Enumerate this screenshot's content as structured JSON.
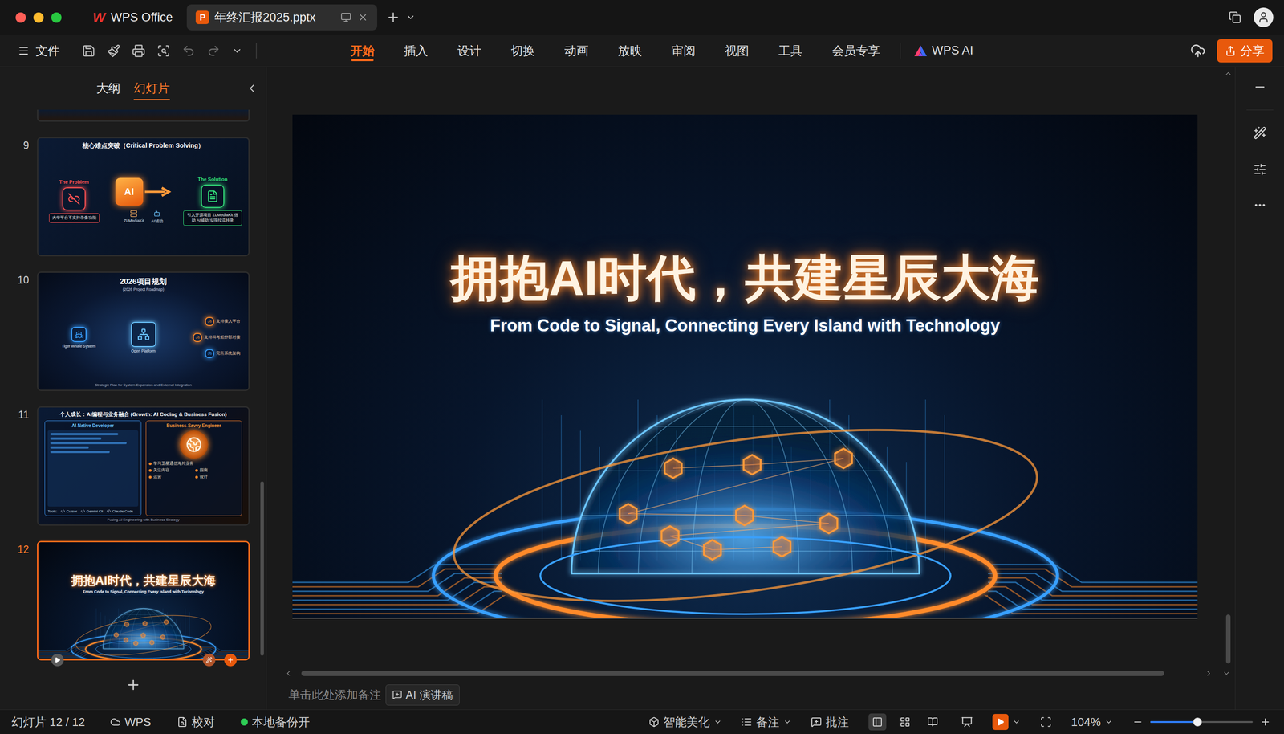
{
  "window": {
    "tabs": [
      {
        "label": "WPS Office",
        "kind": "home",
        "icon": "W",
        "selected": false
      },
      {
        "label": "年终汇报2025.pptx",
        "kind": "doc",
        "icon": "P",
        "selected": true
      }
    ]
  },
  "toolbar": {
    "file": "文件",
    "menus": [
      {
        "label": "开始",
        "selected": true
      },
      {
        "label": "插入",
        "selected": false
      },
      {
        "label": "设计",
        "selected": false
      },
      {
        "label": "切换",
        "selected": false
      },
      {
        "label": "动画",
        "selected": false
      },
      {
        "label": "放映",
        "selected": false
      },
      {
        "label": "审阅",
        "selected": false
      },
      {
        "label": "视图",
        "selected": false
      },
      {
        "label": "工具",
        "selected": false
      },
      {
        "label": "会员专享",
        "selected": false
      }
    ],
    "ai_menu": {
      "label": "WPS AI",
      "selected": false
    },
    "share": "分享"
  },
  "panel": {
    "tabs": [
      {
        "label": "大纲",
        "selected": false
      },
      {
        "label": "幻灯片",
        "selected": true
      }
    ],
    "slides": [
      {
        "number": "9",
        "kind": "problem",
        "selected": false,
        "title": "核心难点突破（Critical Problem Solving）",
        "left_label": "The Problem",
        "right_label": "The Solution",
        "left_note": "大华平台不支持录像功能",
        "right_note": "引入开源项目 ZLMediaKit 借助 AI辅助 实现拉流转录",
        "chip": "AI",
        "tags": [
          "ZLMediaKit",
          "AI辅助"
        ]
      },
      {
        "number": "10",
        "kind": "roadmap",
        "selected": false,
        "title": "2026项目规划",
        "subtitle": "(2026 Project Roadmap)",
        "left_node": "Tiger Whale System",
        "center_node": "Open Platform",
        "right_nodes": [
          "支持接入平台",
          "支持科考船外部对接",
          "完善系统架构"
        ],
        "footer": "Strategic Plan for System Expansion and External Integration"
      },
      {
        "number": "11",
        "kind": "growth",
        "selected": false,
        "title": "个人成长：AI编程与业务融合 (Growth: AI Coding & Business Fusion)",
        "left_card": "AI-Native Developer",
        "tools_label": "Tools:",
        "tools": [
          "Cursor",
          "Gemini Cli",
          "Claude Code"
        ],
        "right_card": "Business-Savvy Engineer",
        "bullets": [
          "学习卫星通信海外业务",
          "关注内容",
          "指南",
          "运营",
          "设计"
        ],
        "footer": "Fusing AI Engineering with Business Strategy"
      },
      {
        "number": "12",
        "kind": "closing",
        "selected": true,
        "title": "拥抱AI时代，共建星辰大海",
        "subtitle": "From Code to Signal, Connecting Every Island with Technology"
      }
    ]
  },
  "slide": {
    "title": "拥抱AI时代，共建星辰大海",
    "subtitle": "From Code to Signal, Connecting Every Island with Technology"
  },
  "notes": {
    "placeholder": "单击此处添加备注",
    "ai_button": "AI 演讲稿"
  },
  "status_bar": {
    "slide_count": "幻灯片 12 / 12",
    "left_items": [
      {
        "label": "WPS",
        "kind": "cloud"
      },
      {
        "label": "校对",
        "kind": "proof"
      }
    ],
    "backup": {
      "label": "本地备份开",
      "on": true
    },
    "right_items": [
      {
        "label": "智能美化",
        "kind": "beautify",
        "dropdown": true
      },
      {
        "label": "备注",
        "kind": "notes",
        "dropdown": true
      },
      {
        "label": "批注",
        "kind": "comment",
        "dropdown": false
      }
    ],
    "views": [
      {
        "kind": "normal",
        "selected": true
      },
      {
        "kind": "sorter",
        "selected": false
      },
      {
        "kind": "reading",
        "selected": false
      }
    ],
    "zoom": "104%",
    "zoom_level": 0.46
  }
}
